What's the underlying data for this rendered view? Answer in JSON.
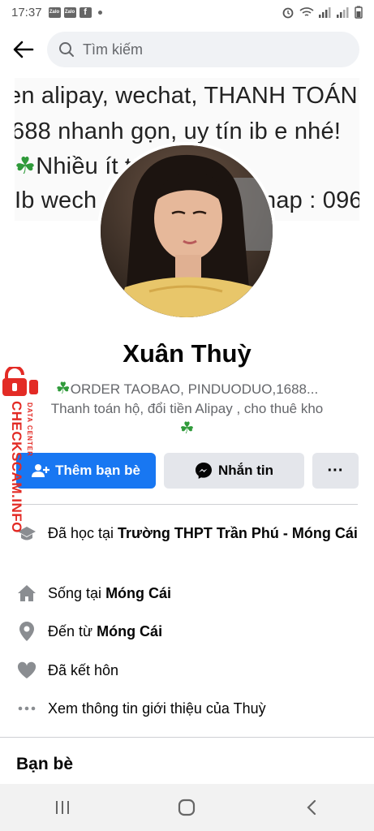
{
  "status_bar": {
    "time": "17:37",
    "badges": [
      "Zalo",
      "Zalo",
      "f"
    ]
  },
  "search": {
    "placeholder": "Tìm kiếm"
  },
  "cover": {
    "line1": "en alipay, wechat, THANH TOÁN",
    "line2": "688 nhanh gọn, uy tín ib e nhé!",
    "line3_clover": "☘",
    "line3": "Nhiều ít t",
    "line4_left": "Ib wech",
    "line4_right": "nap : 096"
  },
  "profile": {
    "name": "Xuân Thuỳ",
    "bio_clover": "☘",
    "bio_line1": "ORDER TAOBAO, PINDUODUO,1688...",
    "bio_line2": "Thanh toán hộ, đổi tiền Alipay , cho thuê kho",
    "bio_clover2": "☘"
  },
  "actions": {
    "add_friend": "Thêm bạn bè",
    "message": "Nhắn tin",
    "more": "···"
  },
  "intro": {
    "studied_prefix": "Đã học tại ",
    "studied_school": "Trường THPT Trần Phú - Móng Cái",
    "lives_prefix": "Sống tại ",
    "lives_place": "Móng Cái",
    "from_prefix": "Đến từ ",
    "from_place": "Móng Cái",
    "relationship": "Đã kết hôn",
    "see_more": "Xem thông tin giới thiệu của Thuỳ"
  },
  "friends": {
    "title": "Bạn bè"
  },
  "watermark": {
    "brand": "CHECKSCAM.INFO",
    "sub": "DATA CENTER"
  },
  "colors": {
    "primary": "#1877f2",
    "secondary_bg": "#e4e6eb",
    "watermark": "#e32b25",
    "clover": "#2f9a3a"
  }
}
